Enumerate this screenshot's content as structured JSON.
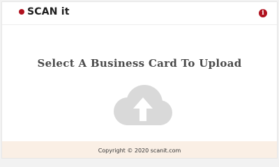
{
  "header": {
    "brand_name": "SCAN it",
    "info_icon_glyph": "i",
    "info_icon_name": "info-icon"
  },
  "main": {
    "prompt": "Select A Business Card To Upload",
    "upload_icon_name": "cloud-upload-icon"
  },
  "footer": {
    "copyright": "Copyright © 2020 scanit.com"
  },
  "colors": {
    "brand": "#b0121f",
    "cloud": "#d9d9d9",
    "footer_bg": "#faefe5"
  }
}
